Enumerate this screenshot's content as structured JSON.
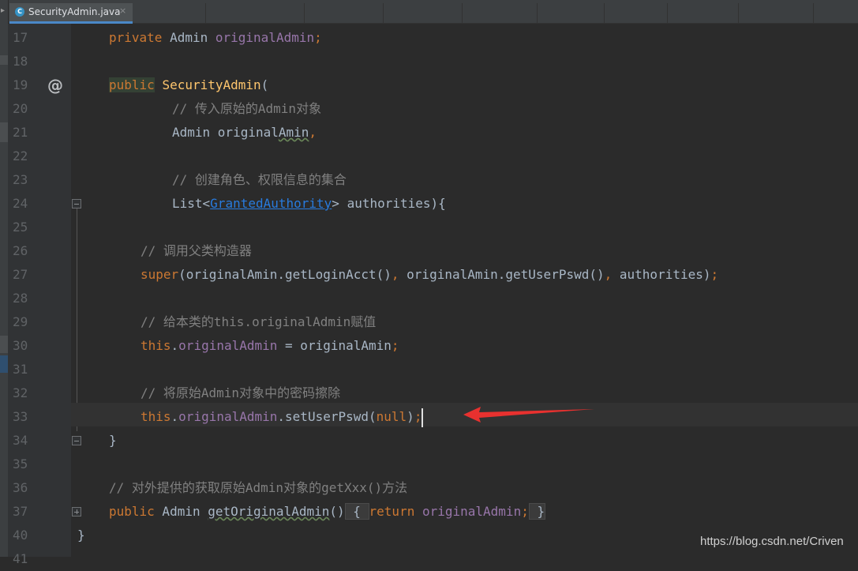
{
  "tab": {
    "icon_letter": "C",
    "title": "SecurityAdmin.java",
    "close": "×"
  },
  "gutter": {
    "line_numbers": [
      "17",
      "18",
      "19",
      "20",
      "21",
      "22",
      "23",
      "24",
      "25",
      "26",
      "27",
      "28",
      "29",
      "30",
      "31",
      "32",
      "33",
      "34",
      "35",
      "36",
      "37",
      "40",
      "41"
    ],
    "override_marker": "@"
  },
  "code": {
    "l17": {
      "kw": "private",
      "t1": " Admin ",
      "fld": "originalAdmin",
      "end": ";"
    },
    "l19": {
      "kw": "public",
      "sp": " ",
      "fn": "SecurityAdmin",
      "end": "("
    },
    "l20": {
      "cmt": "// 传入原始的Admin对象"
    },
    "l21": {
      "t1": "Admin original",
      "squig": "Amin",
      "end": ","
    },
    "l23": {
      "cmt": "// 创建角色、权限信息的集合"
    },
    "l24": {
      "t1": "List",
      "lt": "<",
      "link": "GrantedAuthority",
      "gt": ">",
      "t2": " authorities){"
    },
    "l26": {
      "cmt": "// 调用父类构造器"
    },
    "l27": {
      "kw": "super",
      "t1": "(originalAmin.getLoginAcct()",
      "c1": ",",
      "t2": " originalAmin.getUserPswd()",
      "c2": ",",
      "t3": " authorities)",
      "end": ";"
    },
    "l29": {
      "cmt": "// 给本类的this.originalAdmin赋值"
    },
    "l30": {
      "kw": "this",
      "dot": ".",
      "fld": "originalAdmin",
      "t1": " = originalAmin",
      "end": ";"
    },
    "l32": {
      "cmt": "// 将原始Admin对象中的密码擦除"
    },
    "l33": {
      "kw": "this",
      "dot": ".",
      "fld": "originalAdmin",
      "t1": ".setUserPswd(",
      "kw2": "null",
      "t2": ")",
      "end": ";"
    },
    "l34": {
      "t1": "}"
    },
    "l36": {
      "cmt": "// 对外提供的获取原始Admin对象的getXxx()方法"
    },
    "l37": {
      "kw": "public",
      "t1": " Admin ",
      "squig": "getOriginalAdmin",
      "t2": "()",
      "b1": " { ",
      "kw2": "return",
      "sp": " ",
      "fld": "originalAdmin",
      "end": ";",
      "b2": " }"
    },
    "l40": {
      "t1": "}"
    }
  },
  "watermark": "https://blog.csdn.net/Criven",
  "colors": {
    "background": "#2b2b2b",
    "keyword": "#cc7832",
    "field": "#9876aa",
    "method_decl": "#ffc66d",
    "comment": "#808080",
    "link": "#287bde",
    "arrow": "#e8312f"
  }
}
